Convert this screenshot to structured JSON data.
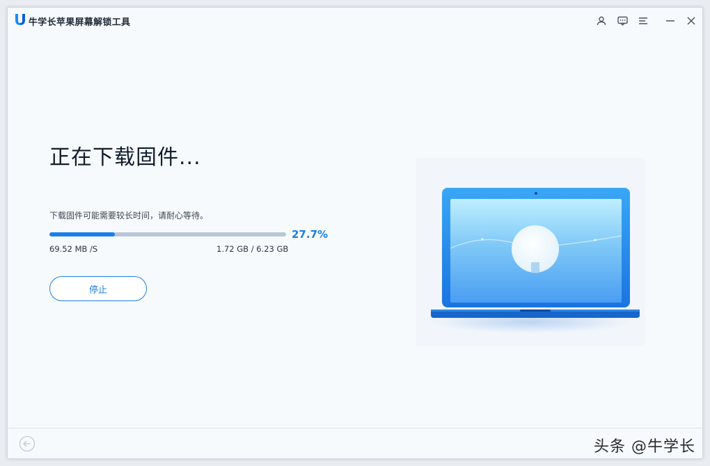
{
  "window": {
    "title": "牛学长苹果屏幕解锁工具",
    "titlebar_icons": [
      "user-icon",
      "feedback-icon",
      "menu-icon",
      "minimize-icon",
      "close-icon"
    ]
  },
  "main": {
    "heading": "正在下载固件...",
    "subtext": "下载固件可能需要较长时间，请耐心等待。",
    "progress": {
      "fraction": 0.277,
      "percent_label": "27.7%",
      "speed": "69.52 MB /S",
      "size": "1.72 GB / 6.23 GB"
    },
    "stop_button": "停止"
  },
  "footer": {
    "back_icon": "back-arrow-icon",
    "watermark": "头条 @牛学长"
  },
  "colors": {
    "accent": "#1a7fe8",
    "track": "#b9c6d6",
    "background": "#f7fafd"
  }
}
